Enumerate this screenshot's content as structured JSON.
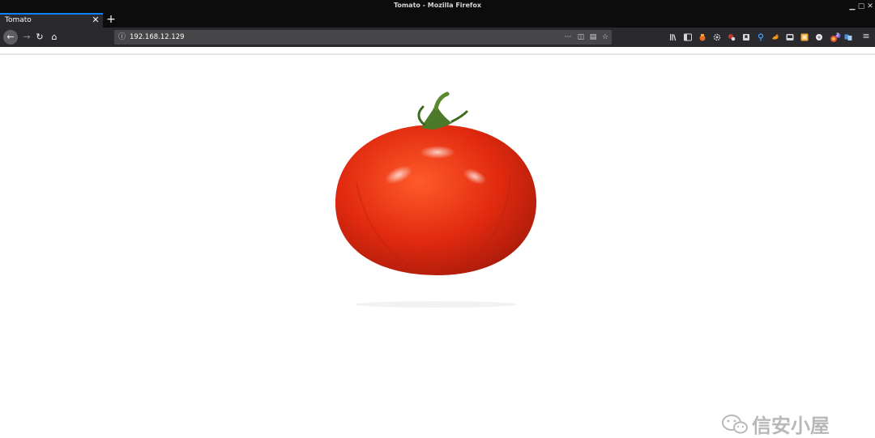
{
  "window": {
    "title": "Tomato - Mozilla Firefox"
  },
  "tabs": [
    {
      "label": "Tomato",
      "close_glyph": "✕"
    }
  ],
  "newtab_glyph": "+",
  "nav": {
    "back_glyph": "←",
    "forward_glyph": "→",
    "reload_glyph": "↻",
    "home_glyph": "⌂"
  },
  "urlbar": {
    "url": "192.168.12.129",
    "info_glyph": "ⓘ",
    "more_glyph": "···",
    "pocket_glyph": "◫",
    "reader_glyph": "▤",
    "bookmark_glyph": "☆"
  },
  "toolbar_icons": [
    "library-icon",
    "sidebar-icon",
    "extension-fox-icon",
    "settings-icon",
    "extension-red-icon",
    "extension-bookmark-icon",
    "extension-pin-icon",
    "extension-orange-icon",
    "extension-screen-icon",
    "extension-note-icon",
    "extension-circle-icon",
    "extension-badge-icon",
    "extension-translate-icon",
    "menu-icon"
  ],
  "badge_count": "2",
  "menu_glyph": "≡",
  "content": {
    "image_name": "tomato"
  },
  "watermark": {
    "text": "信安小屋"
  },
  "colors": {
    "tab_accent": "#0a84ff",
    "tomato": "#e02a0e",
    "stem": "#4d7a2a"
  }
}
